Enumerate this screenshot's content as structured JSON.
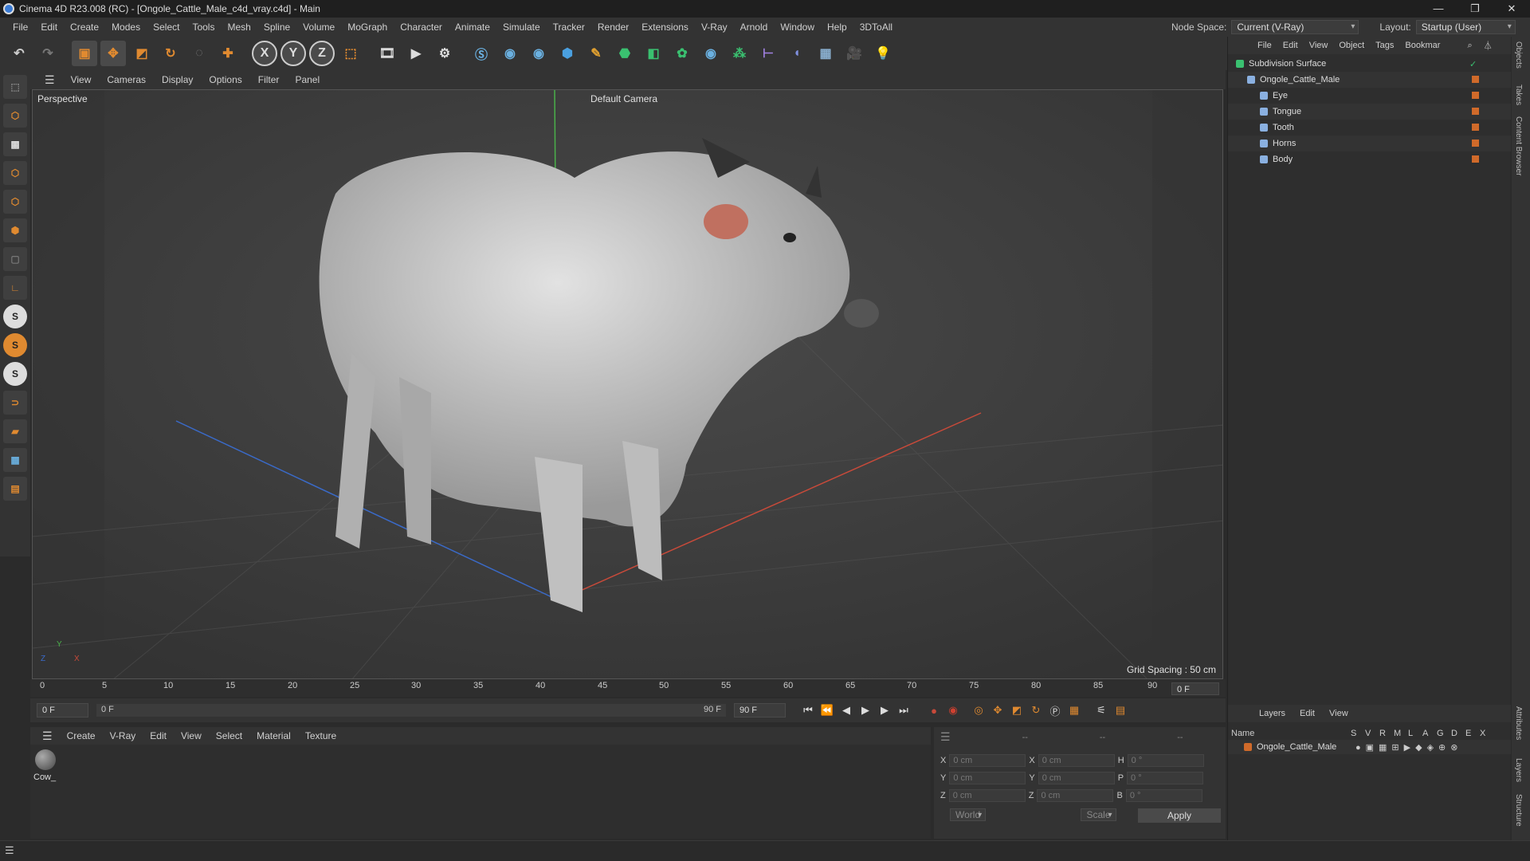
{
  "window": {
    "title": "Cinema 4D R23.008 (RC) - [Ongole_Cattle_Male_c4d_vray.c4d] - Main",
    "controls": [
      "—",
      "❐",
      "✕"
    ]
  },
  "menu": [
    "File",
    "Edit",
    "Create",
    "Modes",
    "Select",
    "Tools",
    "Mesh",
    "Spline",
    "Volume",
    "MoGraph",
    "Character",
    "Animate",
    "Simulate",
    "Tracker",
    "Render",
    "Extensions",
    "V-Ray",
    "Arnold",
    "Window",
    "Help",
    "3DToAll"
  ],
  "nodespace": {
    "label": "Node Space:",
    "value": "Current (V-Ray)",
    "layout_label": "Layout:",
    "layout_value": "Startup (User)"
  },
  "toolbar": {
    "icons": [
      "undo-icon",
      "redo-icon",
      "select-icon",
      "move-icon",
      "scale-icon",
      "rotate-icon",
      "live-select-icon",
      "add-icon",
      "x-axis-icon",
      "y-axis-icon",
      "z-axis-icon",
      "coord-system-icon",
      "render-region-icon",
      "render-view-icon",
      "render-settings-icon",
      "vray-icon",
      "python-icon",
      "python2-icon",
      "cube-icon",
      "pen-icon",
      "subdivision-icon",
      "extrude-icon",
      "array-icon",
      "python3-icon",
      "mograph-icon",
      "deformer-icon",
      "field-icon",
      "floor-icon",
      "camera-icon",
      "light-icon"
    ],
    "axis_labels": [
      "X",
      "Y",
      "Z"
    ]
  },
  "viewport": {
    "menu": [
      "View",
      "Cameras",
      "Display",
      "Options",
      "Filter",
      "Panel"
    ],
    "label": "Perspective",
    "camera": "Default Camera",
    "grid": "Grid Spacing : 50 cm",
    "axis": {
      "x": "X",
      "y": "Y",
      "z": "Z"
    }
  },
  "timeline": {
    "ticks": [
      "0",
      "5",
      "10",
      "15",
      "20",
      "25",
      "30",
      "35",
      "40",
      "45",
      "50",
      "55",
      "60",
      "65",
      "70",
      "75",
      "80",
      "85",
      "90"
    ],
    "current": "0 F",
    "start": "0 F",
    "range_start": "0 F",
    "range_end": "90 F",
    "end": "90 F"
  },
  "material": {
    "menu": [
      "Create",
      "V-Ray",
      "Edit",
      "View",
      "Select",
      "Material",
      "Texture"
    ],
    "items": [
      {
        "name": "Cow_"
      }
    ]
  },
  "coords": {
    "header": [
      "--",
      "--",
      "--"
    ],
    "rows": [
      {
        "a": "X",
        "av": "0 cm",
        "b": "X",
        "bv": "0 cm",
        "c": "H",
        "cv": "0 °"
      },
      {
        "a": "Y",
        "av": "0 cm",
        "b": "Y",
        "bv": "0 cm",
        "c": "P",
        "cv": "0 °"
      },
      {
        "a": "Z",
        "av": "0 cm",
        "b": "Z",
        "bv": "0 cm",
        "c": "B",
        "cv": "0 °"
      }
    ],
    "mode": "World",
    "size": "Scale",
    "apply": "Apply"
  },
  "objects": {
    "menu": [
      "File",
      "Edit",
      "View",
      "Object",
      "Tags",
      "Bookmar"
    ],
    "tree": [
      {
        "name": "Subdivision Surface",
        "indent": 0
      },
      {
        "name": "Ongole_Cattle_Male",
        "indent": 1
      },
      {
        "name": "Eye",
        "indent": 2
      },
      {
        "name": "Tongue",
        "indent": 2
      },
      {
        "name": "Tooth",
        "indent": 2
      },
      {
        "name": "Horns",
        "indent": 2
      },
      {
        "name": "Body",
        "indent": 2
      }
    ]
  },
  "layers": {
    "menu": [
      "Layers",
      "Edit",
      "View"
    ],
    "header": {
      "name": "Name",
      "cols": [
        "S",
        "V",
        "R",
        "M",
        "L",
        "A",
        "G",
        "D",
        "E",
        "X"
      ]
    },
    "rows": [
      {
        "name": "Ongole_Cattle_Male"
      }
    ]
  },
  "side_tabs": [
    "Objects",
    "Takes",
    "Content Browser",
    "Attributes",
    "Layers",
    "Structure"
  ],
  "colors": {
    "accent": "#d06a2a",
    "axis_x": "#c84a3a",
    "axis_y": "#4ab04a",
    "axis_z": "#3a6ac8"
  }
}
